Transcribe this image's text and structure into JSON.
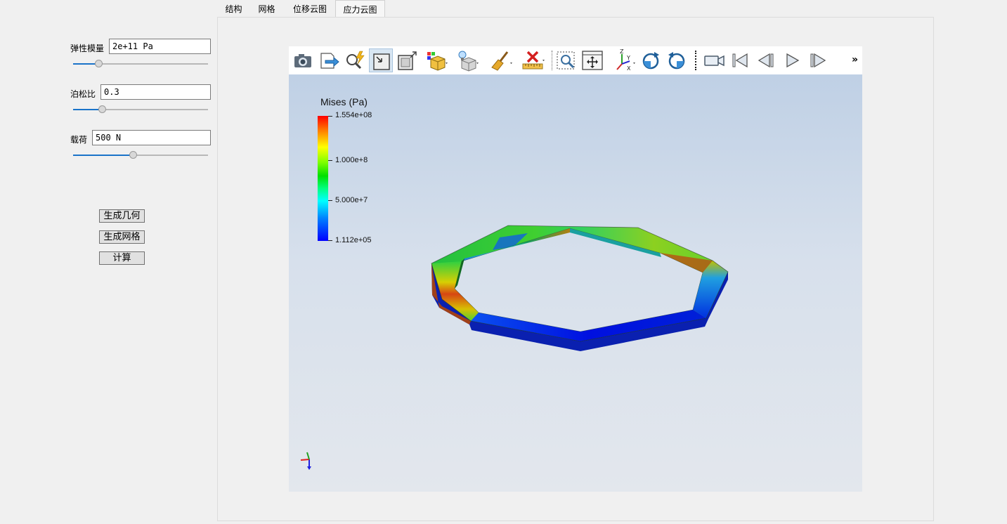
{
  "tabs": [
    {
      "label": "结构"
    },
    {
      "label": "网格"
    },
    {
      "label": "位移云图"
    },
    {
      "label": "应力云图"
    }
  ],
  "params": {
    "elastic_modulus": {
      "label": "弹性模量",
      "value": "2e+11 Pa",
      "slider_fraction": 0.19
    },
    "poisson_ratio": {
      "label": "泊松比",
      "value": "0.3",
      "slider_fraction": 0.22
    },
    "load": {
      "label": "载荷",
      "value": "500 N",
      "slider_fraction": 0.45
    }
  },
  "buttons": {
    "generate_geometry": "生成几何",
    "generate_mesh": "生成网格",
    "compute": "计算"
  },
  "toolbar": {
    "icons": [
      "camera-icon",
      "export-icon",
      "interact-probe-icon",
      "select-icon",
      "box-select-icon",
      "color-legend-icon",
      "lighting-icon",
      "clear-brush-icon",
      "delete-ruler-icon",
      "zoom-to-box-icon",
      "reset-camera-icon",
      "axes-orientation-icon",
      "rotate-cw-icon",
      "rotate-ccw-icon",
      "video-camera-icon",
      "first-frame-icon",
      "previous-frame-icon",
      "play-icon",
      "next-frame-icon"
    ],
    "more_label": "»"
  },
  "colorbar": {
    "title": "Mises (Pa)",
    "max_label": "1.554e+08",
    "mid_high_label": "1.000e+8",
    "mid_low_label": "5.000e+7",
    "min_label": "1.112e+05",
    "colors": [
      "#ff0000",
      "#ffff00",
      "#00e000",
      "#00ffff",
      "#0000ff"
    ]
  },
  "axes_triad": {
    "x": "#e02020",
    "y": "#20a020",
    "z": "#2020e0"
  },
  "colors": {
    "accent": "#1a73c9"
  }
}
